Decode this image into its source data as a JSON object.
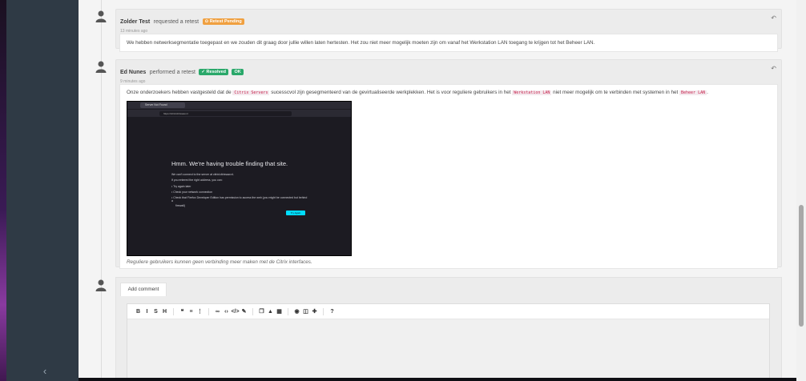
{
  "sidebar": {
    "collapse_icon": "chevron-left-icon",
    "collapse_glyph": "‹"
  },
  "entries": [
    {
      "author": "Zolder Test",
      "action": "requested a retest",
      "badge": "⊙ Retest Pending",
      "time": "13 minutes ago",
      "body": "We hebben netwerksegmentatie toegepast en we zouden dit graag door jullie willen laten hertesten. Het zou niet meer mogelijk moeten zijn om vanaf het Werkstation LAN toegang te krijgen tot het Beheer LAN."
    },
    {
      "author": "Ed Nunes",
      "action": "performed a retest",
      "badge": "✓ Resolved",
      "badge2": "OK",
      "time": "9 minutes ago",
      "body_parts": {
        "p1": "Onze onderzoekers hebben vastgesteld dat de ",
        "c1": "Citrix Servers",
        "p2": " sucesscvol zijn gesegmenteerd van de gevirtualiseerde werkplekken. Het is voor reguliere gebruikers in het ",
        "c2": "Werkstation LAN",
        "p3": " niet meer mogelijk om te verbinden met systemen in het ",
        "c3": "Beheer LAN",
        "p4": "."
      },
      "screenshot": {
        "tab": "Server Not Found",
        "url": "https://citrix/citrixsaw.nl",
        "title": "Hmm. We're having trouble finding that site.",
        "line1": "We can't connect to the server at citrix/citrixsaw.nl.",
        "line2": "If you entered the right address, you can:",
        "bullets": [
          "Try again later",
          "Check your network connection",
          "Check that Firefox Developer Edition has permission to access the web (you might be connected but behind a",
          "firewall)"
        ],
        "button": "Try Again"
      },
      "caption": "Reguliere gebruikers kunnen geen verbinding meer maken met de Citrix interfaces."
    }
  ],
  "comment": {
    "tab_label": "Add comment",
    "toolbar": [
      {
        "name": "bold-icon",
        "glyph": "B"
      },
      {
        "name": "italic-icon",
        "glyph": "I"
      },
      {
        "name": "strikethrough-icon",
        "glyph": "S"
      },
      {
        "name": "heading-icon",
        "glyph": "H"
      },
      {
        "name": "quote-icon",
        "glyph": "❝"
      },
      {
        "name": "unordered-list-icon",
        "glyph": "≡"
      },
      {
        "name": "ordered-list-icon",
        "glyph": "⋮"
      },
      {
        "name": "link-icon",
        "glyph": "∞"
      },
      {
        "name": "code-icon",
        "glyph": "‹›"
      },
      {
        "name": "code-block-icon",
        "glyph": "</>"
      },
      {
        "name": "pen-icon",
        "glyph": "✎"
      },
      {
        "name": "copy-icon",
        "glyph": "❐"
      },
      {
        "name": "warning-icon",
        "glyph": "▲"
      },
      {
        "name": "table-icon",
        "glyph": "▦"
      },
      {
        "name": "preview-icon",
        "glyph": "◉"
      },
      {
        "name": "side-by-side-icon",
        "glyph": "◫"
      },
      {
        "name": "fullscreen-icon",
        "glyph": "✚"
      },
      {
        "name": "help-icon",
        "glyph": "?"
      }
    ]
  }
}
